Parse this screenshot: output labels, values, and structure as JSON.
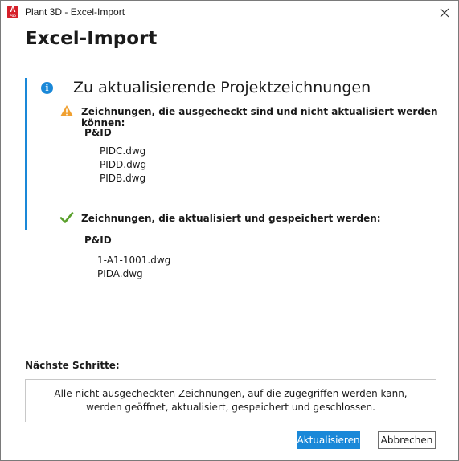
{
  "window": {
    "title": "Plant 3D - Excel-Import",
    "app_icon_letter": "A",
    "app_icon_sub": "P3D",
    "close_icon": "close-icon"
  },
  "dialog": {
    "heading": "Excel-Import",
    "section_title": "Zu aktualisierende Projektzeichnungen",
    "checked_out": {
      "title": "Zeichnungen, die ausgecheckt sind und nicht aktualisiert werden können:",
      "subhead": "P&ID",
      "files": [
        "PIDC.dwg",
        "PIDD.dwg",
        "PIDB.dwg"
      ]
    },
    "updated": {
      "title": "Zeichnungen, die aktualisiert und gespeichert werden:",
      "subhead": "P&ID",
      "files": [
        "1-A1-1001.dwg",
        "PIDA.dwg"
      ]
    },
    "next_steps_label": "Nächste Schritte:",
    "next_steps_line1": "Alle nicht ausgecheckten Zeichnungen, auf die zugegriffen werden kann,",
    "next_steps_line2": "werden geöffnet, aktualisiert, gespeichert und geschlossen."
  },
  "buttons": {
    "update": "Aktualisieren",
    "cancel": "Abbrechen"
  },
  "colors": {
    "accent": "#1a88d8",
    "warning": "#f0a030",
    "success": "#5aa02c",
    "brand": "#d6202a"
  }
}
